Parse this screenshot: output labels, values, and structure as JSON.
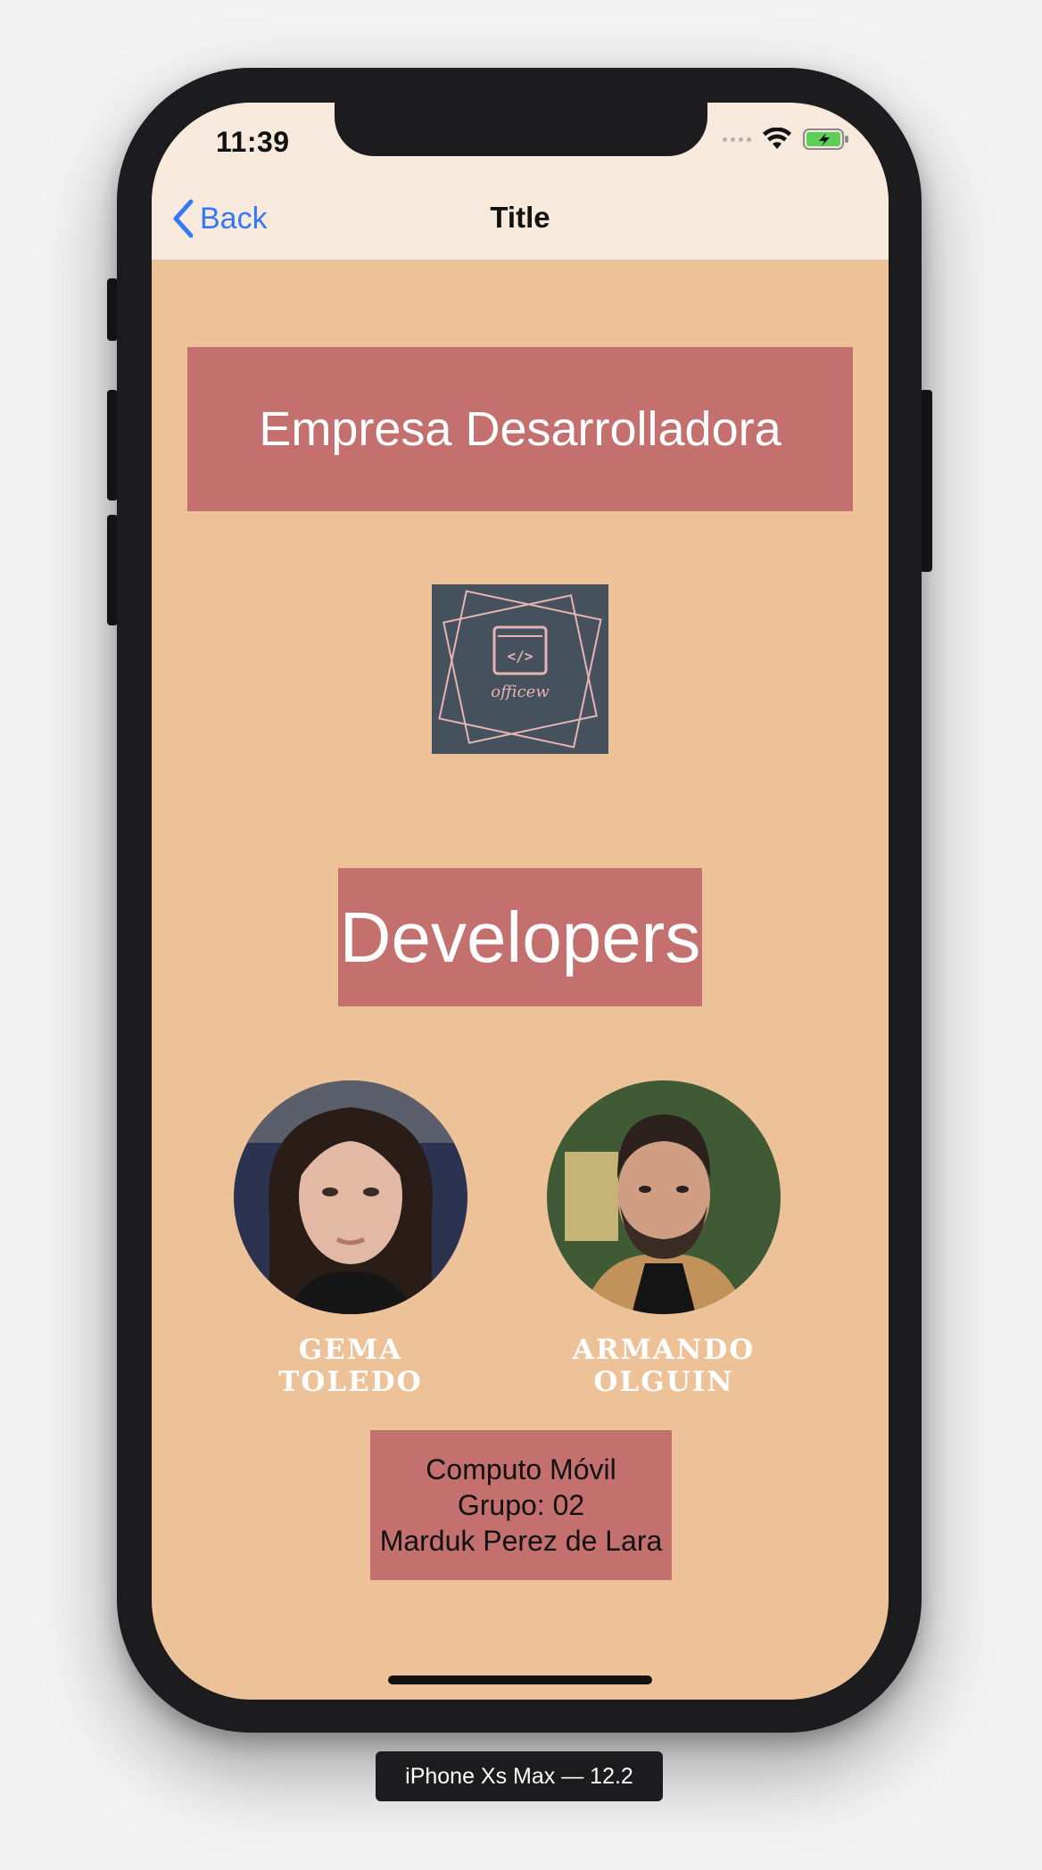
{
  "status_bar": {
    "time": "11:39"
  },
  "nav": {
    "back_label": "Back",
    "title": "Title"
  },
  "content": {
    "company_title": "Empresa Desarrolladora",
    "logo_text": "officew",
    "developers_title": "Developers",
    "developers": [
      {
        "name": "GEMA TOLEDO"
      },
      {
        "name": "ARMANDO OLGUIN"
      }
    ],
    "info": {
      "course": "Computo Móvil",
      "group": "Grupo: 02",
      "teacher": "Marduk Perez de Lara"
    }
  },
  "simulator": {
    "device_label": "iPhone Xs Max — 12.2"
  },
  "colors": {
    "background": "#edc298",
    "nav_bar": "#f7eadc",
    "banner": "#c3706e",
    "link": "#3478f6",
    "logo_bg": "#45525e"
  }
}
